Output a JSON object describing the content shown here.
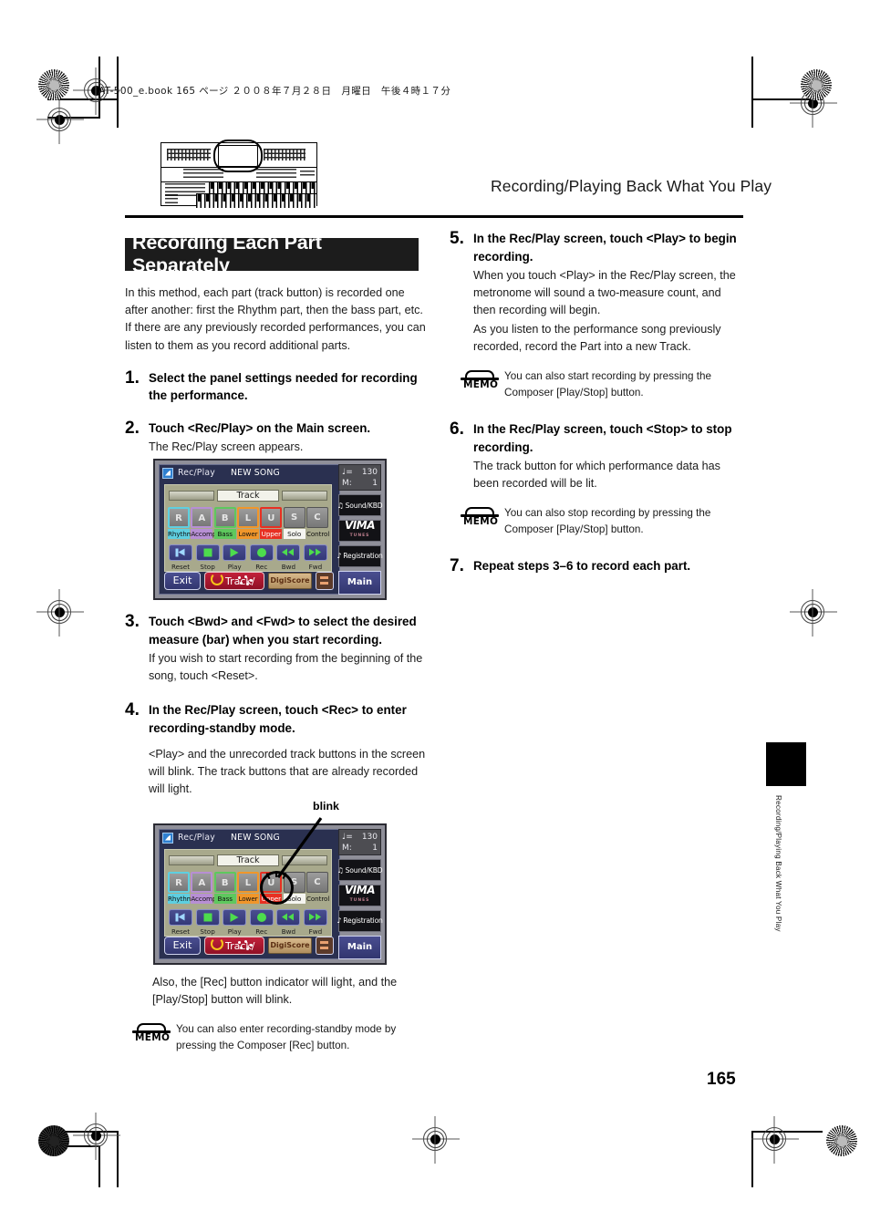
{
  "print_marks": {
    "file_line": "AT-500_e.book  165 ページ  ２００８年７月２８日　月曜日　午後４時１７分"
  },
  "header": {
    "running_head": "Recording/Playing Back What You Play",
    "organ_illustration": "organ-front-panel-illustration"
  },
  "banner": {
    "title": "Recording Each Part Separately"
  },
  "intro": {
    "paragraph": "In this method, each part (track button) is recorded one after another: first the Rhythm part, then the bass part, etc. If there are any previously recorded performances, you can listen to them as you record additional parts."
  },
  "steps_left": [
    {
      "num": "1.",
      "head": "Select the panel settings needed for recording the performance.",
      "sub": []
    },
    {
      "num": "2.",
      "head": "Touch <Rec/Play> on the Main screen.",
      "sub": [
        "The Rec/Play screen appears."
      ]
    },
    {
      "num": "3.",
      "head": "Touch <Bwd> and <Fwd> to select the desired measure (bar) when you start recording.",
      "sub": [
        "If you wish to start recording from the beginning of the song, touch <Reset>."
      ]
    },
    {
      "num": "4.",
      "head": "In the Rec/Play screen, touch <Rec> to enter recording-standby mode.",
      "sub": [
        "<Play> and the unrecorded track buttons in the screen will blink. The track buttons that are already recorded will light."
      ]
    }
  ],
  "steps_right": [
    {
      "num": "5.",
      "head": "In the Rec/Play screen, touch <Play> to begin recording.",
      "sub": [
        "When you touch <Play> in the Rec/Play screen, the metronome will sound a two-measure count, and then recording will begin.",
        "As you listen to the performance song previously recorded, record the Part into a new Track."
      ]
    },
    {
      "num": "6.",
      "head": "In the Rec/Play screen, touch <Stop> to stop recording.",
      "sub": [
        "The track button for which performance data has been recorded will be lit."
      ]
    },
    {
      "num": "7.",
      "head": "Repeat steps 3–6 to record each part.",
      "sub": []
    }
  ],
  "after_fig4": {
    "text": "Also, the [Rec] button indicator will light, and the [Play/Stop] button will blink."
  },
  "memos": {
    "memo_label": "MEMO",
    "memo5": "You can also start recording by pressing the Composer [Play/Stop] button.",
    "memo6": "You can also stop recording by pressing the Composer [Play/Stop] button.",
    "memo4": "You can also enter recording-standby mode by pressing the Composer [Rec] button."
  },
  "callout": {
    "blink_label": "blink"
  },
  "lcd": {
    "title": "Rec/Play",
    "song": "NEW SONG",
    "track_label": "Track",
    "tracks": [
      {
        "letter": "R",
        "name": "Rhythm",
        "color": "#5ecfe0"
      },
      {
        "letter": "A",
        "name": "Accomp",
        "color": "#b78fd4"
      },
      {
        "letter": "B",
        "name": "Bass",
        "color": "#5ec85e"
      },
      {
        "letter": "L",
        "name": "Lower",
        "color": "#f0962a"
      },
      {
        "letter": "U",
        "name": "Upper",
        "color": "#e83022"
      },
      {
        "letter": "S",
        "name": "Solo",
        "color": "#f5f5f0"
      },
      {
        "letter": "C",
        "name": "Control",
        "color": "#a8a98c"
      }
    ],
    "transport": [
      {
        "name": "Reset",
        "icon": "skip-back-icon"
      },
      {
        "name": "Stop",
        "icon": "stop-icon"
      },
      {
        "name": "Play",
        "icon": "play-icon"
      },
      {
        "name": "Rec",
        "icon": "record-icon"
      },
      {
        "name": "Bwd",
        "icon": "rewind-icon"
      },
      {
        "name": "Fwd",
        "icon": "fast-forward-icon"
      }
    ],
    "bottom": {
      "exit": "Exit",
      "track_menu": "Track/",
      "digiscore": "DigiScore",
      "square_icon": "mixer-icon"
    },
    "side": {
      "tempo_value": "130",
      "tempo_symbol": "♩=",
      "measure_label": "M:",
      "measure_value": "1",
      "sound_kbd": "Sound/KBD",
      "vima": "VIMA",
      "vima_sub": "TUNES",
      "registration": "Registration",
      "main": "Main"
    }
  },
  "side_tab": {
    "vertical_text": "Recording/Playing Back What You Play"
  },
  "footer": {
    "page_number": "165"
  }
}
